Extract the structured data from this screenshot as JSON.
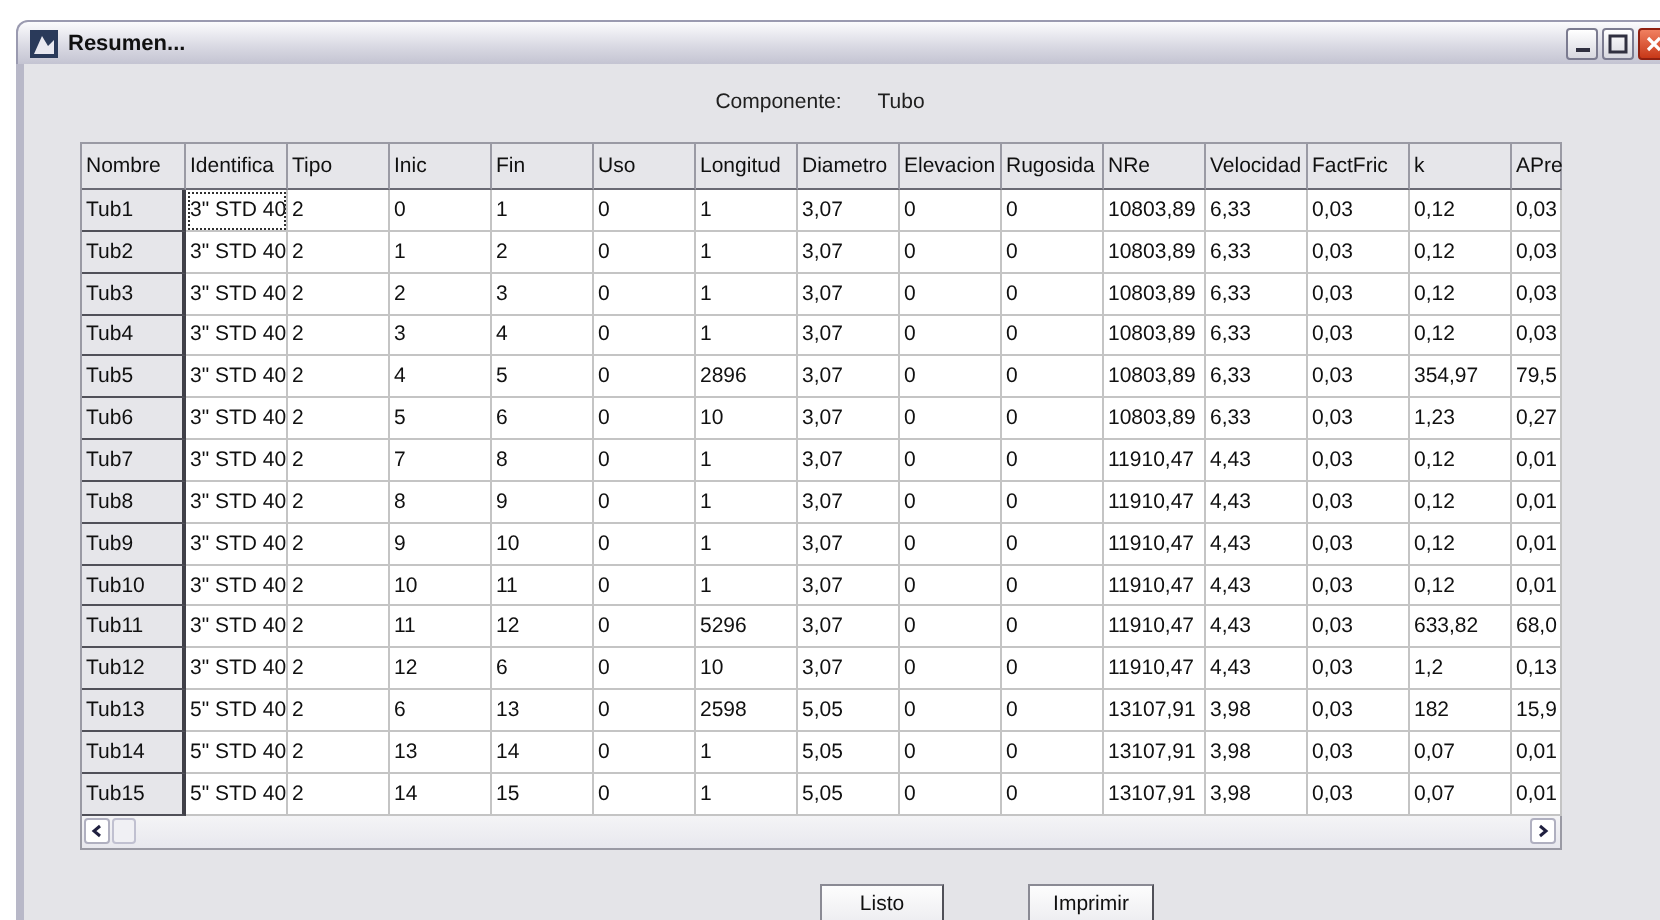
{
  "window": {
    "title": "Resumen..."
  },
  "component": {
    "label": "Componente:",
    "value": "Tubo"
  },
  "table": {
    "columns": [
      "Nombre",
      "Identifica",
      "Tipo",
      "Inic",
      "Fin",
      "Uso",
      "Longitud",
      "Diametro",
      "Elevacion",
      "Rugosida",
      "NRe",
      "Velocidad",
      "FactFric",
      "k",
      "APre"
    ],
    "rows": [
      {
        "name": "Tub1",
        "identification": {
          "text": "3\" STD 40",
          "focused": true
        },
        "values": [
          "2",
          "0",
          "1",
          "0",
          "1",
          "3,07",
          "0",
          "0",
          "10803,89",
          "6,33",
          "0,03",
          "0,12",
          "0,03"
        ]
      },
      {
        "name": "Tub2",
        "identification": {
          "text": "3\" STD 40",
          "focused": false
        },
        "values": [
          "2",
          "1",
          "2",
          "0",
          "1",
          "3,07",
          "0",
          "0",
          "10803,89",
          "6,33",
          "0,03",
          "0,12",
          "0,03"
        ]
      },
      {
        "name": "Tub3",
        "identification": {
          "text": "3\" STD 40",
          "focused": false
        },
        "values": [
          "2",
          "2",
          "3",
          "0",
          "1",
          "3,07",
          "0",
          "0",
          "10803,89",
          "6,33",
          "0,03",
          "0,12",
          "0,03"
        ]
      },
      {
        "name": "Tub4",
        "identification": {
          "text": "3\" STD 40",
          "focused": false
        },
        "values": [
          "2",
          "3",
          "4",
          "0",
          "1",
          "3,07",
          "0",
          "0",
          "10803,89",
          "6,33",
          "0,03",
          "0,12",
          "0,03"
        ]
      },
      {
        "name": "Tub5",
        "identification": {
          "text": "3\" STD 40",
          "focused": false
        },
        "values": [
          "2",
          "4",
          "5",
          "0",
          "2896",
          "3,07",
          "0",
          "0",
          "10803,89",
          "6,33",
          "0,03",
          "354,97",
          "79,5"
        ]
      },
      {
        "name": "Tub6",
        "identification": {
          "text": "3\" STD 40",
          "focused": false
        },
        "values": [
          "2",
          "5",
          "6",
          "0",
          "10",
          "3,07",
          "0",
          "0",
          "10803,89",
          "6,33",
          "0,03",
          "1,23",
          "0,27"
        ]
      },
      {
        "name": "Tub7",
        "identification": {
          "text": "3\" STD 40",
          "focused": false
        },
        "values": [
          "2",
          "7",
          "8",
          "0",
          "1",
          "3,07",
          "0",
          "0",
          "11910,47",
          "4,43",
          "0,03",
          "0,12",
          "0,01"
        ]
      },
      {
        "name": "Tub8",
        "identification": {
          "text": "3\" STD 40",
          "focused": false
        },
        "values": [
          "2",
          "8",
          "9",
          "0",
          "1",
          "3,07",
          "0",
          "0",
          "11910,47",
          "4,43",
          "0,03",
          "0,12",
          "0,01"
        ]
      },
      {
        "name": "Tub9",
        "identification": {
          "text": "3\" STD 40",
          "focused": false
        },
        "values": [
          "2",
          "9",
          "10",
          "0",
          "1",
          "3,07",
          "0",
          "0",
          "11910,47",
          "4,43",
          "0,03",
          "0,12",
          "0,01"
        ]
      },
      {
        "name": "Tub10",
        "identification": {
          "text": "3\" STD 40",
          "focused": false
        },
        "values": [
          "2",
          "10",
          "11",
          "0",
          "1",
          "3,07",
          "0",
          "0",
          "11910,47",
          "4,43",
          "0,03",
          "0,12",
          "0,01"
        ]
      },
      {
        "name": "Tub11",
        "identification": {
          "text": "3\" STD 40",
          "focused": false
        },
        "values": [
          "2",
          "11",
          "12",
          "0",
          "5296",
          "3,07",
          "0",
          "0",
          "11910,47",
          "4,43",
          "0,03",
          "633,82",
          "68,0"
        ]
      },
      {
        "name": "Tub12",
        "identification": {
          "text": "3\" STD 40",
          "focused": false
        },
        "values": [
          "2",
          "12",
          "6",
          "0",
          "10",
          "3,07",
          "0",
          "0",
          "11910,47",
          "4,43",
          "0,03",
          "1,2",
          "0,13"
        ]
      },
      {
        "name": "Tub13",
        "identification": {
          "text": "5\" STD 40",
          "focused": false
        },
        "values": [
          "2",
          "6",
          "13",
          "0",
          "2598",
          "5,05",
          "0",
          "0",
          "13107,91",
          "3,98",
          "0,03",
          "182",
          "15,9"
        ]
      },
      {
        "name": "Tub14",
        "identification": {
          "text": "5\" STD 40",
          "focused": false
        },
        "values": [
          "2",
          "13",
          "14",
          "0",
          "1",
          "5,05",
          "0",
          "0",
          "13107,91",
          "3,98",
          "0,03",
          "0,07",
          "0,01"
        ]
      },
      {
        "name": "Tub15",
        "identification": {
          "text": "5\" STD 40",
          "focused": false
        },
        "values": [
          "2",
          "14",
          "15",
          "0",
          "1",
          "5,05",
          "0",
          "0",
          "13107,91",
          "3,98",
          "0,03",
          "0,07",
          "0,01"
        ]
      }
    ]
  },
  "buttons": [
    {
      "label": "Listo"
    },
    {
      "label": "Imprimir"
    }
  ]
}
